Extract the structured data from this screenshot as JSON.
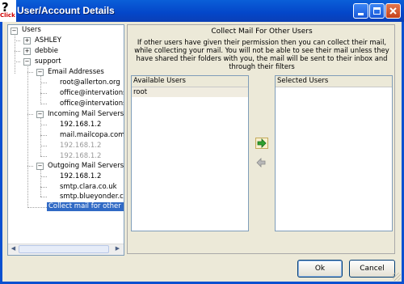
{
  "window": {
    "title": "User/Account Details",
    "app_icon_glyph": "?",
    "app_icon_label": "Click"
  },
  "tree": {
    "root": "Users",
    "users": [
      {
        "label": "ASHLEY",
        "expander": "+"
      },
      {
        "label": "debbie",
        "expander": "+"
      },
      {
        "label": "support",
        "expander": "−"
      }
    ],
    "groups": [
      {
        "label": "Email Addresses",
        "items": [
          {
            "label": "root@allerton.org",
            "state": "normal"
          },
          {
            "label": "office@intervations",
            "state": "normal"
          },
          {
            "label": "office@intervations",
            "state": "normal"
          }
        ]
      },
      {
        "label": "Incoming Mail Servers",
        "items": [
          {
            "label": "192.168.1.2",
            "state": "normal"
          },
          {
            "label": "mail.mailcopa.com",
            "state": "normal"
          },
          {
            "label": "192.168.1.2",
            "state": "disabled"
          },
          {
            "label": "192.168.1.2",
            "state": "disabled"
          }
        ]
      },
      {
        "label": "Outgoing Mail Servers (S",
        "items": [
          {
            "label": "192.168.1.2",
            "state": "normal"
          },
          {
            "label": "smtp.clara.co.uk",
            "state": "normal"
          },
          {
            "label": "smtp.blueyonder.co",
            "state": "normal"
          }
        ]
      }
    ],
    "selected_item": "Collect mail for other use"
  },
  "panel": {
    "title": "Collect Mail For Other Users",
    "description": "If other users have given their permission then you can collect their mail, while collecting your mail.  You will not be able to see their mail unless they have shared their folders with you, the mail will be sent to their inbox and through their filters",
    "available": {
      "header": "Available Users",
      "items": [
        "root"
      ]
    },
    "selected": {
      "header": "Selected Users",
      "items": []
    }
  },
  "buttons": {
    "ok": "Ok",
    "cancel": "Cancel"
  },
  "colors": {
    "titlebar": "#0446c9",
    "selection": "#316ac5",
    "move_arrow": "#2fa12f"
  },
  "icons": [
    "minimize-icon",
    "maximize-icon",
    "close-icon",
    "move-right-arrow-icon",
    "move-left-arrow-icon"
  ]
}
